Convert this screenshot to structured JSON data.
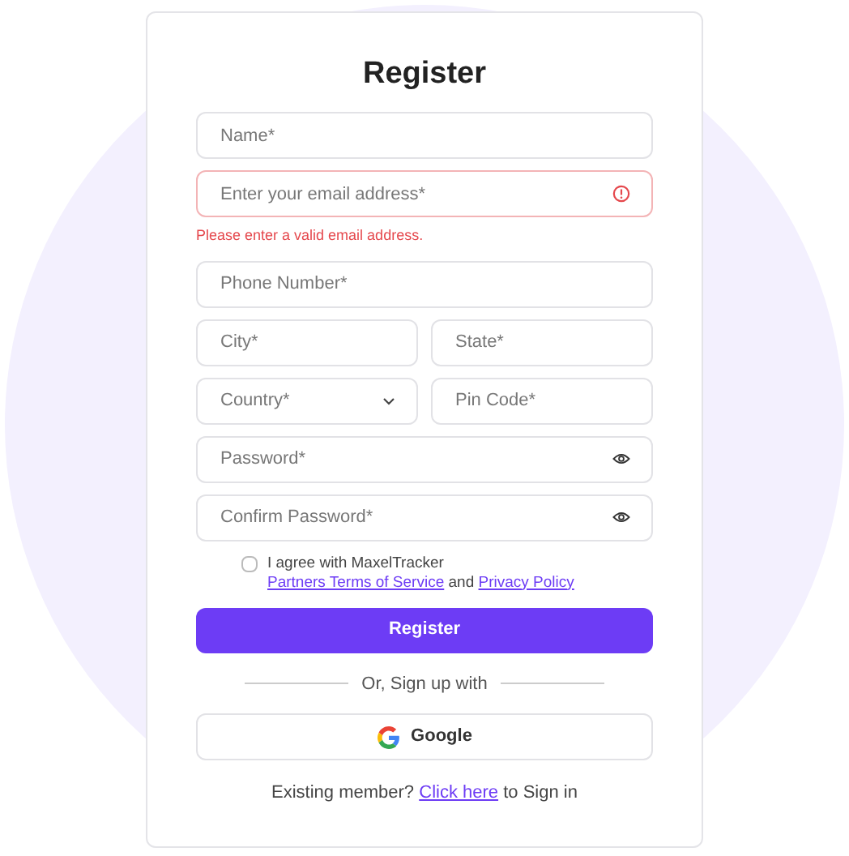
{
  "title": "Register",
  "rows": [
    [
      {
        "kind": "text",
        "placeholder": "Name*",
        "invalid": false
      }
    ],
    [
      {
        "kind": "text",
        "placeholder": "Enter your email address*",
        "invalid": true,
        "error": "Please enter a valid email address."
      }
    ],
    [
      {
        "kind": "text",
        "placeholder": "Phone Number*",
        "invalid": false
      }
    ],
    [
      {
        "kind": "text",
        "placeholder": "City*",
        "invalid": false
      },
      {
        "kind": "text",
        "placeholder": "State*",
        "invalid": false
      }
    ],
    [
      {
        "kind": "select",
        "placeholder": "Country*",
        "invalid": false
      },
      {
        "kind": "text",
        "placeholder": "Pin Code*",
        "invalid": false
      }
    ],
    [
      {
        "kind": "password",
        "placeholder": "Password*",
        "invalid": false
      }
    ],
    [
      {
        "kind": "password",
        "placeholder": "Confirm Password*",
        "invalid": false
      }
    ]
  ],
  "agreement": {
    "checked": false,
    "parts": [
      {
        "kind": "text",
        "text": "I agree with MaxelTracker"
      },
      {
        "kind": "link",
        "text": "Partners Terms of Service"
      },
      {
        "kind": "text",
        "text": "and"
      },
      {
        "kind": "link",
        "text": "Privacy Policy"
      }
    ]
  },
  "submit": "Register",
  "divider": "Or, Sign up with",
  "google": "Google",
  "signin": [
    {
      "kind": "text",
      "text": "Existing member?"
    },
    {
      "kind": "link",
      "text": "Click here"
    },
    {
      "kind": "text",
      "text": "to Sign in"
    }
  ]
}
